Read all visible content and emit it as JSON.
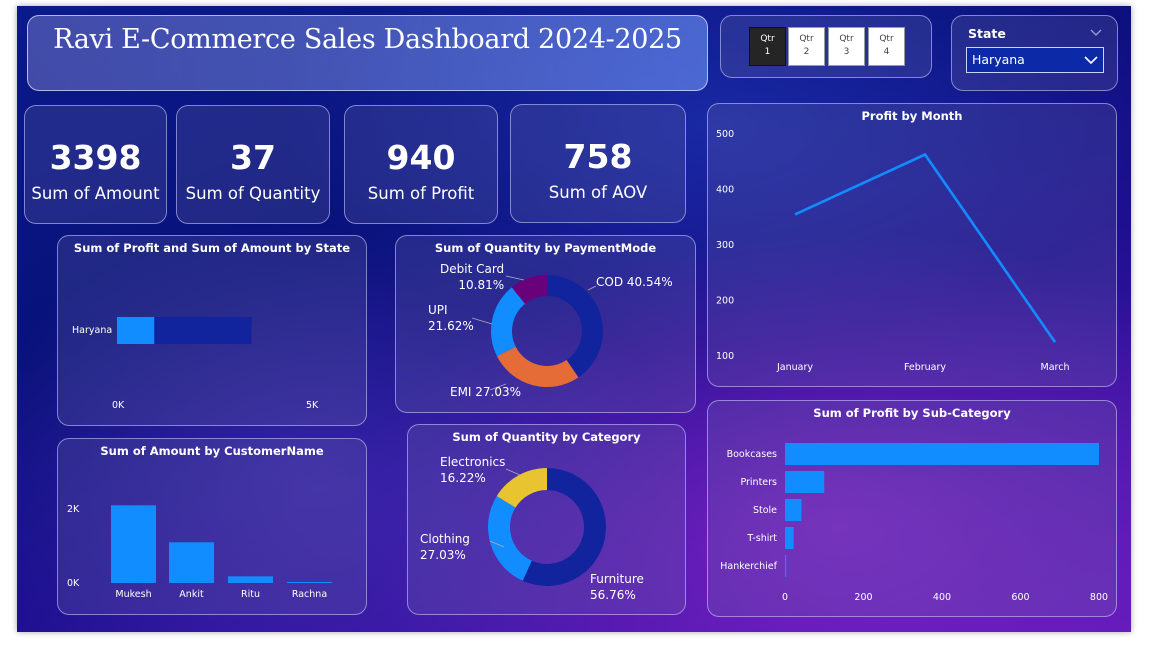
{
  "title": "Ravi E-Commerce Sales Dashboard 2024-2025",
  "quarters": [
    {
      "line1": "Qtr",
      "line2": "1",
      "selected": true
    },
    {
      "line1": "Qtr",
      "line2": "2",
      "selected": false
    },
    {
      "line1": "Qtr",
      "line2": "3",
      "selected": false
    },
    {
      "line1": "Qtr",
      "line2": "4",
      "selected": false
    }
  ],
  "state_slicer": {
    "label": "State",
    "value": "Haryana"
  },
  "kpis": [
    {
      "value": "3398",
      "label": "Sum of Amount"
    },
    {
      "value": "37",
      "label": "Sum of Quantity"
    },
    {
      "value": "940",
      "label": "Sum of Profit"
    },
    {
      "value": "758",
      "label": "Sum of AOV"
    }
  ],
  "colors": {
    "accent": "#118DFF",
    "navy": "#12239E",
    "orange": "#E66C37",
    "purple": "#6B007B",
    "yellow": "#E8C430"
  },
  "chart_data": [
    {
      "type": "bar",
      "orientation": "horizontal",
      "title": "Sum of Profit and Sum of Amount by State",
      "categories": [
        "Haryana"
      ],
      "series": [
        {
          "name": "Sum of Profit",
          "values": [
            940
          ]
        },
        {
          "name": "Sum of Amount",
          "values": [
            3398
          ]
        }
      ],
      "tick_labels": [
        "0K",
        "5K"
      ],
      "xlim": [
        0,
        5000
      ]
    },
    {
      "type": "pie",
      "donut": true,
      "title": "Sum of Quantity by PaymentMode",
      "categories": [
        "COD",
        "EMI",
        "UPI",
        "Debit Card"
      ],
      "values": [
        40.54,
        27.03,
        21.62,
        10.81
      ],
      "labels": [
        "COD 40.54%",
        "EMI 27.03%",
        "UPI\n21.62%",
        "Debit Card\n10.81%"
      ]
    },
    {
      "type": "line",
      "title": "Profit by Month",
      "categories": [
        "January",
        "February",
        "March"
      ],
      "values": [
        355,
        463,
        125
      ],
      "yticks": [
        "500",
        "400",
        "300",
        "200",
        "100"
      ],
      "ylim": [
        100,
        500
      ]
    },
    {
      "type": "bar",
      "title": "Sum of Amount by CustomerName",
      "categories": [
        "Mukesh",
        "Ankit",
        "Ritu",
        "Rachna"
      ],
      "values": [
        2100,
        1100,
        180,
        18
      ],
      "yticks": [
        "2K",
        "0K"
      ],
      "ylim": [
        0,
        2000
      ]
    },
    {
      "type": "pie",
      "donut": true,
      "title": "Sum of Quantity by Category",
      "categories": [
        "Furniture",
        "Clothing",
        "Electronics"
      ],
      "values": [
        56.76,
        27.03,
        16.22
      ],
      "labels": [
        "Furniture\n56.76%",
        "Clothing\n27.03%",
        "Electronics\n16.22%"
      ]
    },
    {
      "type": "bar",
      "orientation": "horizontal",
      "title": "Sum of Profit by Sub-Category",
      "categories": [
        "Bookcases",
        "Printers",
        "Stole",
        "T-shirt",
        "Hankerchief"
      ],
      "values": [
        800,
        100,
        42,
        22,
        3
      ],
      "xticks": [
        "0",
        "200",
        "400",
        "600",
        "800"
      ],
      "xlim": [
        0,
        800
      ]
    }
  ]
}
